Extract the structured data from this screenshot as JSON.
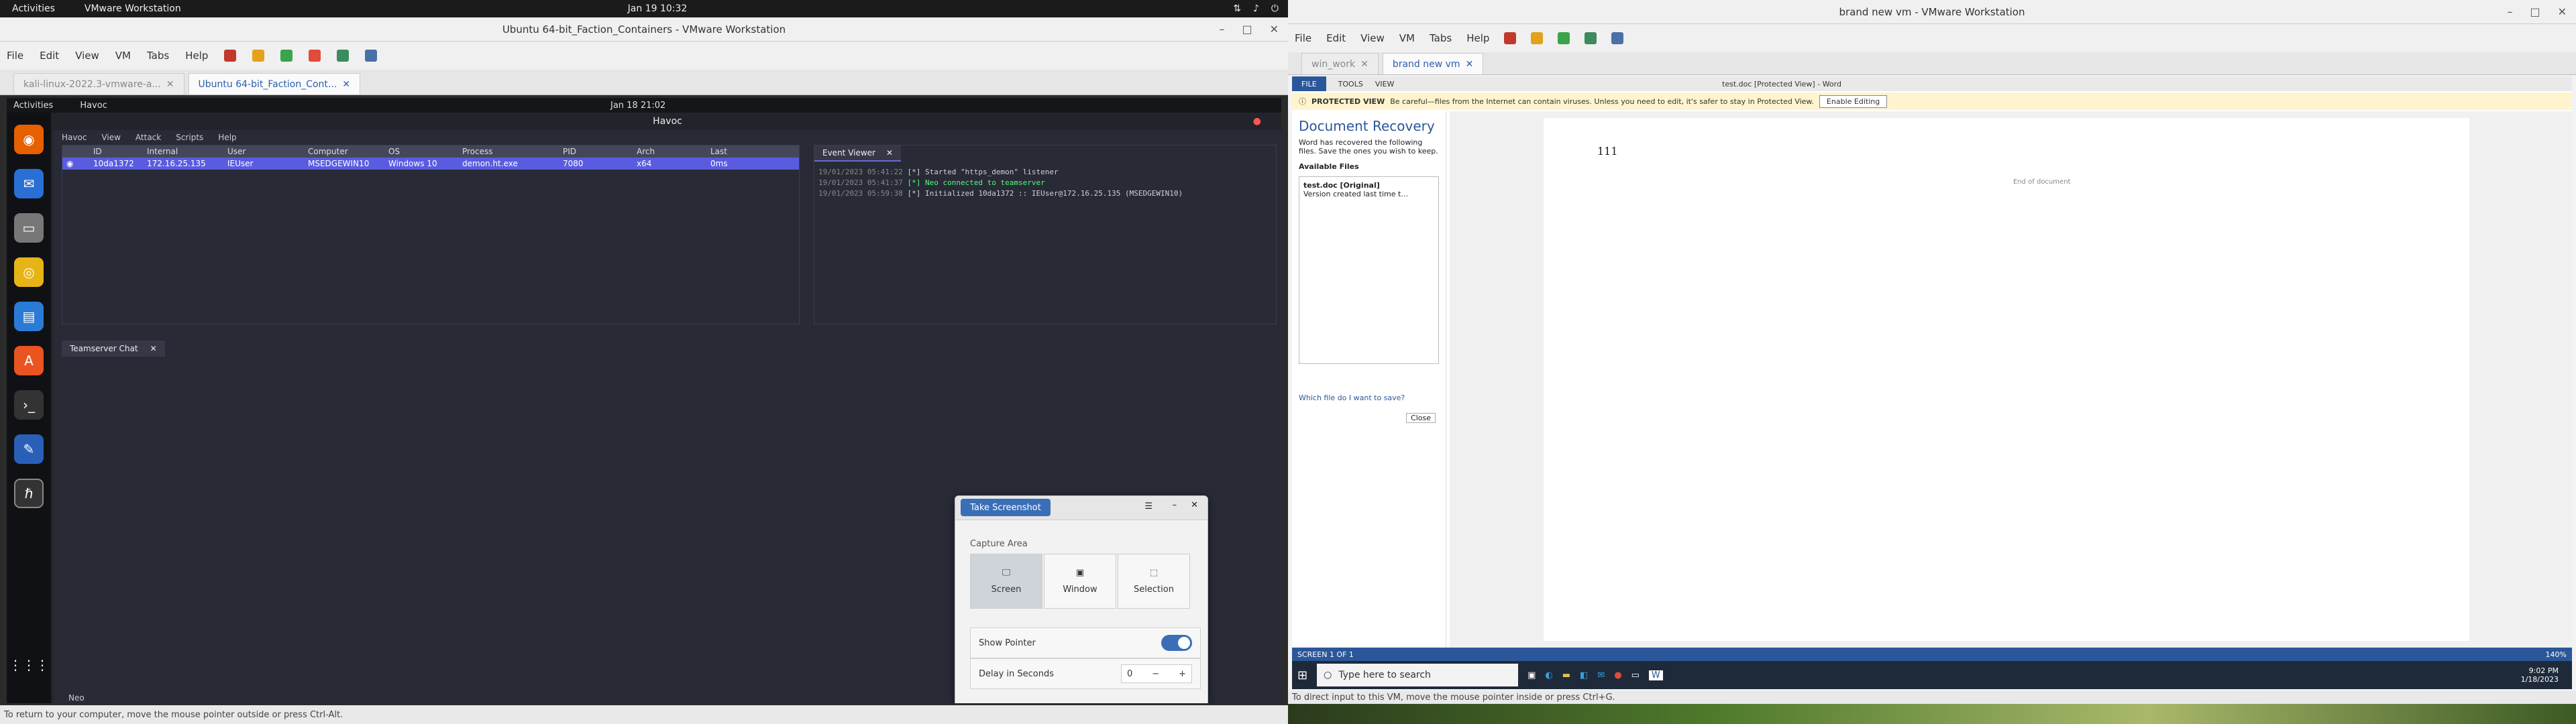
{
  "gnome": {
    "activities": "Activities",
    "app": "VMware Workstation",
    "clock": "Jan 19  10:32"
  },
  "left_vm": {
    "title": "Ubuntu 64-bit_Faction_Containers - VMware Workstation",
    "menu": [
      "File",
      "Edit",
      "View",
      "VM",
      "Tabs",
      "Help"
    ],
    "tabs": [
      "kali-linux-2022.3-vmware-a...",
      "Ubuntu 64-bit_Faction_Cont..."
    ],
    "ubuntu": {
      "activities": "Activities",
      "app": "Havoc",
      "clock": "Jan 18  21:02"
    },
    "havoc": {
      "title": "Havoc",
      "menu": [
        "Havoc",
        "View",
        "Attack",
        "Scripts",
        "Help"
      ],
      "columns": [
        "ID",
        "Internal",
        "User",
        "Computer",
        "OS",
        "Process",
        "PID",
        "Arch",
        "Last"
      ],
      "rows": [
        [
          "10da1372",
          "172.16.25.135",
          "IEUser",
          "MSEDGEWIN10",
          "Windows 10",
          "demon.ht.exe",
          "7080",
          "x64",
          "0ms"
        ]
      ],
      "event_tab": "Event Viewer",
      "events": [
        {
          "ts": "19/01/2023 05:41:22",
          "msg": "[*] Started \"https_demon\" listener"
        },
        {
          "ts": "19/01/2023 05:41:37",
          "msg": "[*] Neo connected to teamserver"
        },
        {
          "ts": "19/01/2023 05:59:38",
          "msg": "[*] Initialized 10da1372 :: IEUser@172.16.25.135 (MSEDGEWIN10)"
        }
      ],
      "chat_tab": "Teamserver Chat",
      "user": "Neo"
    },
    "screenshot": {
      "take": "Take Screenshot",
      "capture_area": "Capture Area",
      "options": [
        "Screen",
        "Window",
        "Selection"
      ],
      "show_pointer": "Show Pointer",
      "delay": "Delay in Seconds",
      "delay_value": "0"
    },
    "hint": "To return to your computer, move the mouse pointer outside or press Ctrl-Alt."
  },
  "right_vm": {
    "title": "brand new vm - VMware Workstation",
    "menu": [
      "File",
      "Edit",
      "View",
      "VM",
      "Tabs",
      "Help"
    ],
    "tabs": [
      "win_work",
      "brand new vm"
    ],
    "word": {
      "ribbon": [
        "FILE",
        "TOOLS",
        "VIEW"
      ],
      "doc_title": "test.doc [Protected View] - Word",
      "pv_label": "PROTECTED VIEW",
      "pv_text": "Be careful—files from the Internet can contain viruses. Unless you need to edit, it's safer to stay in Protected View.",
      "pv_button": "Enable Editing",
      "recovery_title": "Document Recovery",
      "recovery_desc": "Word has recovered the following files. Save the ones you wish to keep.",
      "available": "Available Files",
      "file_name": "test.doc [Original]",
      "file_desc": "Version created last time t...",
      "which_file": "Which file do I want to save?",
      "close": "Close",
      "body_text": "111",
      "end_marker": "End of document",
      "status": "SCREEN 1 OF 1",
      "zoom": "140%"
    },
    "taskbar": {
      "search_placeholder": "Type here to search",
      "time": "9:02 PM",
      "date": "1/18/2023"
    },
    "hint": "To direct input to this VM, move the mouse pointer inside or press Ctrl+G."
  },
  "colors": {
    "havoc_bg": "#282a36",
    "selected_row": "#5a5ce0",
    "word_blue": "#2b579a",
    "accent": "#3a6fb7"
  }
}
